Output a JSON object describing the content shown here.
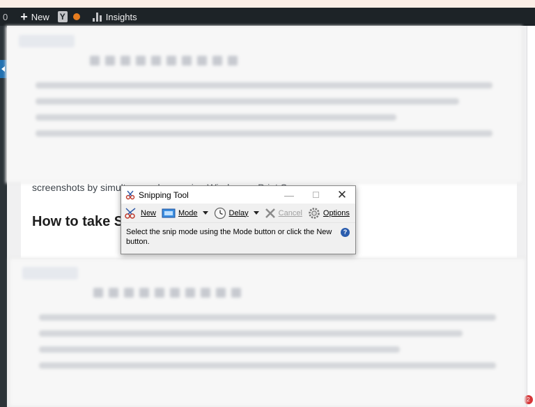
{
  "adminbar": {
    "count": "0",
    "new_label": "New",
    "yoast_letter": "Y",
    "insights_label": "Insights",
    "icons": [
      "plus-icon",
      "yoast-icon",
      "status-dot-icon",
      "insights-bar-icon"
    ]
  },
  "article": {
    "text_line": "screenshots by simultaneously pressing Windows + Print Screen",
    "heading": "How to take Screenshots with Snipping Tool"
  },
  "snipping_tool": {
    "title": "Snipping Tool",
    "toolbar": {
      "new_label": "New",
      "mode_label": "Mode",
      "delay_label": "Delay",
      "cancel_label": "Cancel",
      "options_label": "Options"
    },
    "message": "Select the snip mode using the Mode button or click the New button.",
    "help": "?"
  },
  "notification": {
    "count": "2"
  },
  "colors": {
    "adminbar_bg": "#1d2327",
    "accent_blue": "#2271b1",
    "orange_dot": "#e77d1f",
    "window_bg": "#f0f0f0"
  }
}
